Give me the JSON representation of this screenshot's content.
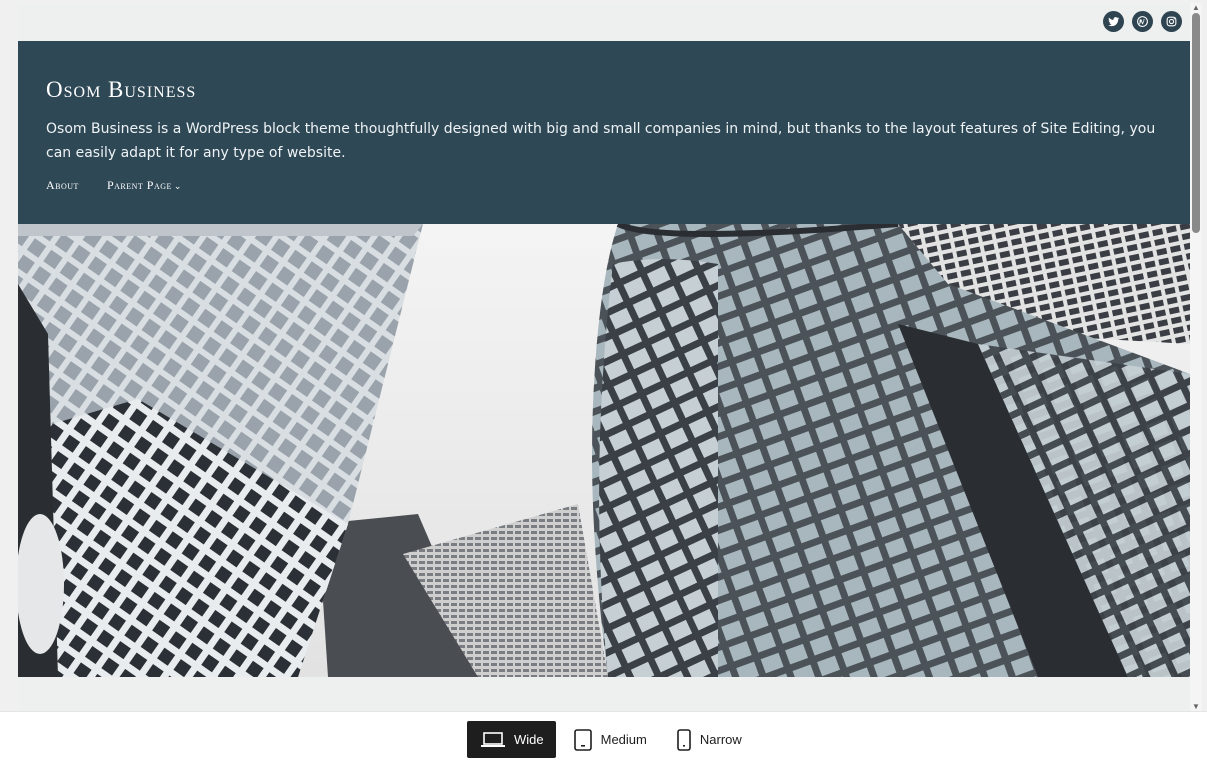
{
  "social": {
    "icons": [
      "twitter-icon",
      "wordpress-icon",
      "instagram-icon"
    ]
  },
  "site": {
    "title": "Osom Business",
    "tagline": "Osom Business is a WordPress block theme thoughtfully designed with big and small companies in mind, but thanks to the layout features of Site Editing, you can easily adapt it for any type of website."
  },
  "nav": {
    "items": [
      {
        "label": "About"
      },
      {
        "label": "Parent Page"
      }
    ]
  },
  "viewport_switcher": {
    "options": [
      {
        "label": "Wide",
        "active": true,
        "icon": "laptop-icon"
      },
      {
        "label": "Medium",
        "active": false,
        "icon": "tablet-icon"
      },
      {
        "label": "Narrow",
        "active": false,
        "icon": "phone-icon"
      }
    ]
  },
  "colors": {
    "header_bg": "#2f4856",
    "active_button_bg": "#1e1e1e"
  }
}
